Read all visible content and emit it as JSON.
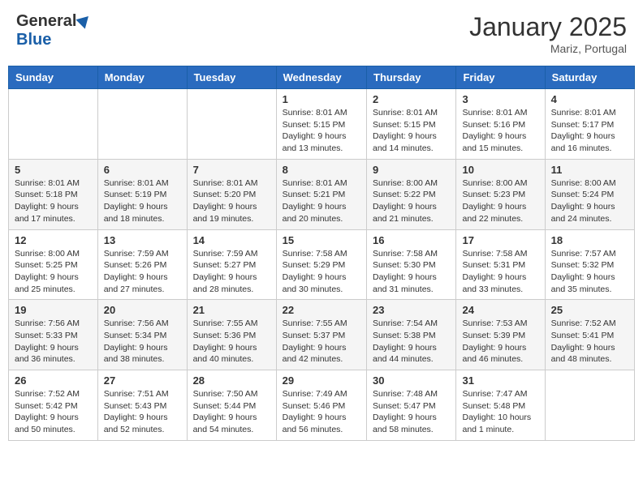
{
  "header": {
    "logo_general": "General",
    "logo_blue": "Blue",
    "month": "January 2025",
    "location": "Mariz, Portugal"
  },
  "columns": [
    "Sunday",
    "Monday",
    "Tuesday",
    "Wednesday",
    "Thursday",
    "Friday",
    "Saturday"
  ],
  "weeks": [
    [
      {
        "day": "",
        "info": ""
      },
      {
        "day": "",
        "info": ""
      },
      {
        "day": "",
        "info": ""
      },
      {
        "day": "1",
        "info": "Sunrise: 8:01 AM\nSunset: 5:15 PM\nDaylight: 9 hours\nand 13 minutes."
      },
      {
        "day": "2",
        "info": "Sunrise: 8:01 AM\nSunset: 5:15 PM\nDaylight: 9 hours\nand 14 minutes."
      },
      {
        "day": "3",
        "info": "Sunrise: 8:01 AM\nSunset: 5:16 PM\nDaylight: 9 hours\nand 15 minutes."
      },
      {
        "day": "4",
        "info": "Sunrise: 8:01 AM\nSunset: 5:17 PM\nDaylight: 9 hours\nand 16 minutes."
      }
    ],
    [
      {
        "day": "5",
        "info": "Sunrise: 8:01 AM\nSunset: 5:18 PM\nDaylight: 9 hours\nand 17 minutes."
      },
      {
        "day": "6",
        "info": "Sunrise: 8:01 AM\nSunset: 5:19 PM\nDaylight: 9 hours\nand 18 minutes."
      },
      {
        "day": "7",
        "info": "Sunrise: 8:01 AM\nSunset: 5:20 PM\nDaylight: 9 hours\nand 19 minutes."
      },
      {
        "day": "8",
        "info": "Sunrise: 8:01 AM\nSunset: 5:21 PM\nDaylight: 9 hours\nand 20 minutes."
      },
      {
        "day": "9",
        "info": "Sunrise: 8:00 AM\nSunset: 5:22 PM\nDaylight: 9 hours\nand 21 minutes."
      },
      {
        "day": "10",
        "info": "Sunrise: 8:00 AM\nSunset: 5:23 PM\nDaylight: 9 hours\nand 22 minutes."
      },
      {
        "day": "11",
        "info": "Sunrise: 8:00 AM\nSunset: 5:24 PM\nDaylight: 9 hours\nand 24 minutes."
      }
    ],
    [
      {
        "day": "12",
        "info": "Sunrise: 8:00 AM\nSunset: 5:25 PM\nDaylight: 9 hours\nand 25 minutes."
      },
      {
        "day": "13",
        "info": "Sunrise: 7:59 AM\nSunset: 5:26 PM\nDaylight: 9 hours\nand 27 minutes."
      },
      {
        "day": "14",
        "info": "Sunrise: 7:59 AM\nSunset: 5:27 PM\nDaylight: 9 hours\nand 28 minutes."
      },
      {
        "day": "15",
        "info": "Sunrise: 7:58 AM\nSunset: 5:29 PM\nDaylight: 9 hours\nand 30 minutes."
      },
      {
        "day": "16",
        "info": "Sunrise: 7:58 AM\nSunset: 5:30 PM\nDaylight: 9 hours\nand 31 minutes."
      },
      {
        "day": "17",
        "info": "Sunrise: 7:58 AM\nSunset: 5:31 PM\nDaylight: 9 hours\nand 33 minutes."
      },
      {
        "day": "18",
        "info": "Sunrise: 7:57 AM\nSunset: 5:32 PM\nDaylight: 9 hours\nand 35 minutes."
      }
    ],
    [
      {
        "day": "19",
        "info": "Sunrise: 7:56 AM\nSunset: 5:33 PM\nDaylight: 9 hours\nand 36 minutes."
      },
      {
        "day": "20",
        "info": "Sunrise: 7:56 AM\nSunset: 5:34 PM\nDaylight: 9 hours\nand 38 minutes."
      },
      {
        "day": "21",
        "info": "Sunrise: 7:55 AM\nSunset: 5:36 PM\nDaylight: 9 hours\nand 40 minutes."
      },
      {
        "day": "22",
        "info": "Sunrise: 7:55 AM\nSunset: 5:37 PM\nDaylight: 9 hours\nand 42 minutes."
      },
      {
        "day": "23",
        "info": "Sunrise: 7:54 AM\nSunset: 5:38 PM\nDaylight: 9 hours\nand 44 minutes."
      },
      {
        "day": "24",
        "info": "Sunrise: 7:53 AM\nSunset: 5:39 PM\nDaylight: 9 hours\nand 46 minutes."
      },
      {
        "day": "25",
        "info": "Sunrise: 7:52 AM\nSunset: 5:41 PM\nDaylight: 9 hours\nand 48 minutes."
      }
    ],
    [
      {
        "day": "26",
        "info": "Sunrise: 7:52 AM\nSunset: 5:42 PM\nDaylight: 9 hours\nand 50 minutes."
      },
      {
        "day": "27",
        "info": "Sunrise: 7:51 AM\nSunset: 5:43 PM\nDaylight: 9 hours\nand 52 minutes."
      },
      {
        "day": "28",
        "info": "Sunrise: 7:50 AM\nSunset: 5:44 PM\nDaylight: 9 hours\nand 54 minutes."
      },
      {
        "day": "29",
        "info": "Sunrise: 7:49 AM\nSunset: 5:46 PM\nDaylight: 9 hours\nand 56 minutes."
      },
      {
        "day": "30",
        "info": "Sunrise: 7:48 AM\nSunset: 5:47 PM\nDaylight: 9 hours\nand 58 minutes."
      },
      {
        "day": "31",
        "info": "Sunrise: 7:47 AM\nSunset: 5:48 PM\nDaylight: 10 hours\nand 1 minute."
      },
      {
        "day": "",
        "info": ""
      }
    ]
  ]
}
